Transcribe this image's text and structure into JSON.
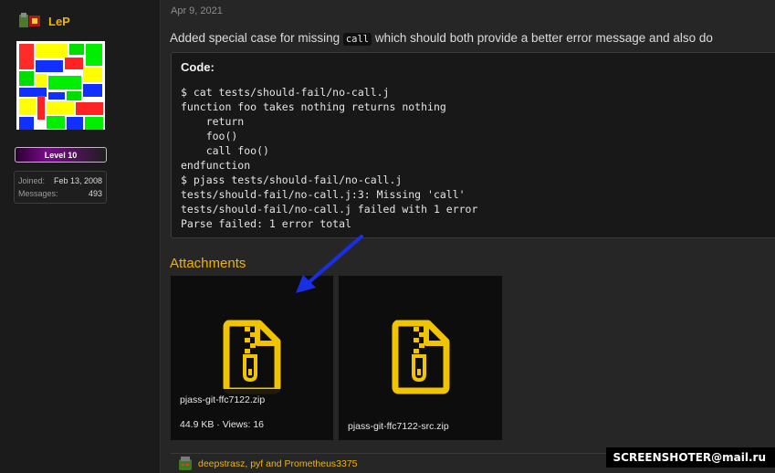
{
  "user": {
    "name": "LeP",
    "level": "Level 10",
    "joined_label": "Joined:",
    "joined_value": "Feb 13, 2008",
    "messages_label": "Messages:",
    "messages_value": "493"
  },
  "post": {
    "date": "Apr 9, 2021",
    "text_before": "Added special case for missing ",
    "inline_code": "call",
    "text_after": " which should both provide a better error message and also do",
    "code_title": "Code:",
    "code_lines": [
      "$ cat tests/should-fail/no-call.j",
      "function foo takes nothing returns nothing",
      "    return",
      "    foo()",
      "    call foo()",
      "endfunction",
      "$ pjass tests/should-fail/no-call.j",
      "tests/should-fail/no-call.j:3: Missing 'call'",
      "tests/should-fail/no-call.j failed with 1 error",
      "Parse failed: 1 error total"
    ]
  },
  "attachments": {
    "heading": "Attachments",
    "files": [
      {
        "name": "pjass-git-ffc7122.zip",
        "meta": "44.9 KB · Views: 16",
        "icon": "zip-file-icon"
      },
      {
        "name": "pjass-git-ffc7122-src.zip",
        "meta": "",
        "icon": "zip-file-icon"
      }
    ]
  },
  "reactions": {
    "text": "deepstrasz, pyf and Prometheus3375"
  },
  "watermark": {
    "text": "SCREENSHOTER@mail.ru"
  },
  "colors": {
    "accent": "#f0b400",
    "background": "#262626",
    "sidebar": "#1b1b1b",
    "arrow": "#1a2ee8"
  }
}
